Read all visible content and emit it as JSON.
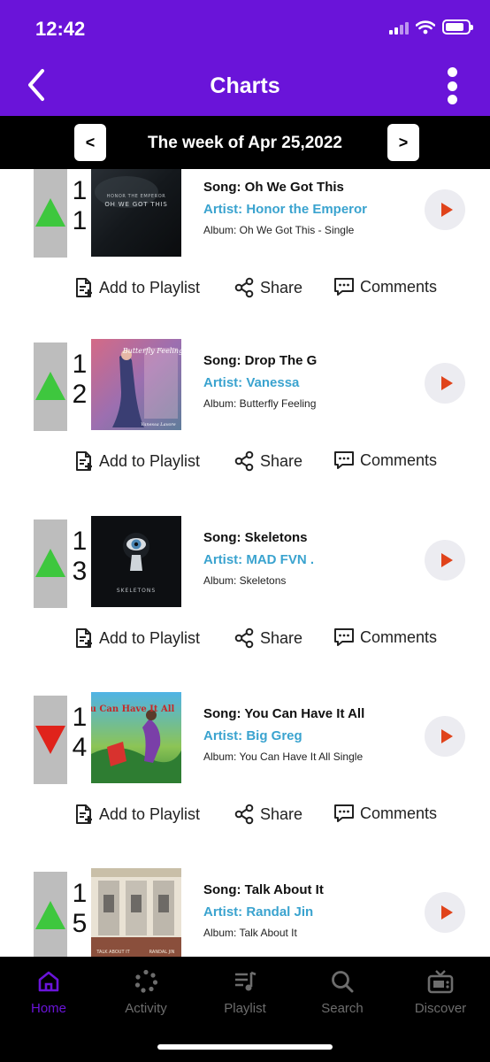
{
  "status": {
    "time": "12:42"
  },
  "header": {
    "title": "Charts"
  },
  "week": {
    "label": "The week of Apr 25,2022",
    "prev_label": "<",
    "next_label": ">"
  },
  "actions": {
    "add_to_playlist": "Add to Playlist",
    "share": "Share",
    "comments": "Comments"
  },
  "entries": [
    {
      "rank_top": "1",
      "rank_bottom": "1",
      "trend": "up",
      "song": "Song: Oh We Got This",
      "artist": "Artist: Honor the Emperor",
      "album": "Album: Oh We Got This - Single",
      "art_text_1": "HONOR THE EMPEROR",
      "art_text_2": "OH WE GOT THIS"
    },
    {
      "rank_top": "1",
      "rank_bottom": "2",
      "trend": "up",
      "song": "Song: Drop The G",
      "artist": "Artist: Vanessa",
      "album": "Album: Butterfly Feeling",
      "art_text_1": "Butterfly Feeling",
      "art_text_2": "Vanessa Lavore"
    },
    {
      "rank_top": "1",
      "rank_bottom": "3",
      "trend": "up",
      "song": "Song: Skeletons",
      "artist": "Artist: MAD FVN .",
      "album": "Album: Skeletons",
      "art_text_1": "SKELETONS"
    },
    {
      "rank_top": "1",
      "rank_bottom": "4",
      "trend": "down",
      "song": "Song: You Can Have It All",
      "artist": "Artist: Big Greg",
      "album": "Album: You Can Have It All Single",
      "art_text_1": "You Can Have It All"
    },
    {
      "rank_top": "1",
      "rank_bottom": "5",
      "trend": "up",
      "song": "Song: Talk About It",
      "artist": "Artist: Randal Jin",
      "album": "Album: Talk About It",
      "art_text_1": "TALK ABOUT IT",
      "art_text_2": "RANDAL JIN"
    }
  ],
  "tabs": [
    {
      "label": "Home",
      "icon": "home-icon",
      "active": true
    },
    {
      "label": "Activity",
      "icon": "activity-icon"
    },
    {
      "label": "Playlist",
      "icon": "playlist-icon"
    },
    {
      "label": "Search",
      "icon": "search-icon"
    },
    {
      "label": "Discover",
      "icon": "tv-icon"
    }
  ],
  "colors": {
    "brand": "#6A14D9",
    "artist": "#3aa3cf",
    "trend_up": "#3ec73e",
    "trend_down": "#e0231b",
    "play": "#e0431b"
  }
}
